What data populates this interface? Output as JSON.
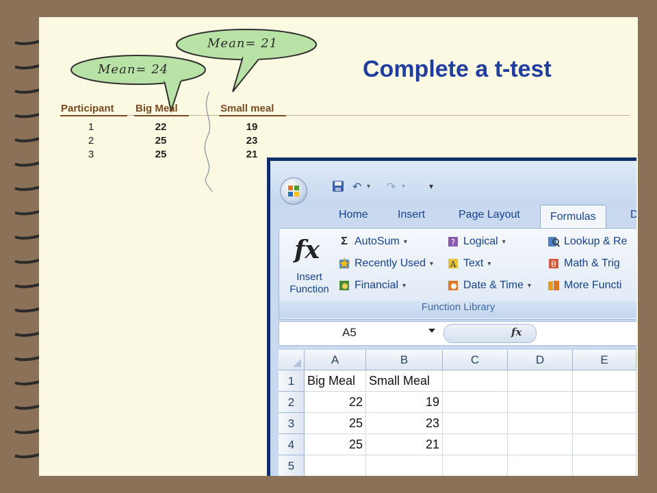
{
  "slide": {
    "title": "Complete a t-test",
    "bubble_left": "Mean= 24",
    "bubble_right": "Mean= 21"
  },
  "table": {
    "headers": [
      "Participant",
      "Big Meal",
      "Small meal"
    ],
    "participants": [
      "1",
      "2",
      "3"
    ],
    "big_meal": [
      "22",
      "25",
      "25"
    ],
    "small_meal": [
      "19",
      "23",
      "21"
    ]
  },
  "excel": {
    "tabs": [
      "Home",
      "Insert",
      "Page Layout",
      "Formulas",
      "D"
    ],
    "active_tab": "Formulas",
    "insert_function_label": [
      "Insert",
      "Function"
    ],
    "fx_glyph": "fx",
    "buttons_col1": [
      "AutoSum",
      "Recently Used",
      "Financial"
    ],
    "buttons_col2": [
      "Logical",
      "Text",
      "Date & Time"
    ],
    "buttons_col3": [
      "Lookup & Re",
      "Math & Trig",
      "More Functi"
    ],
    "group_label": "Function Library",
    "name_box": "A5",
    "columns": [
      "A",
      "B",
      "C",
      "D",
      "E"
    ],
    "rows": [
      "1",
      "2",
      "3",
      "4",
      "5"
    ],
    "cells": [
      [
        "Big Meal",
        "Small Meal"
      ],
      [
        "22",
        "19"
      ],
      [
        "25",
        "23"
      ],
      [
        "25",
        "21"
      ],
      [
        "",
        ""
      ]
    ]
  },
  "colors": {
    "background": "#8b7158",
    "paper": "#fbf9e1",
    "title": "#1f3e9e",
    "bubble": "#b9e3a6",
    "header_text": "#7a4b22"
  }
}
